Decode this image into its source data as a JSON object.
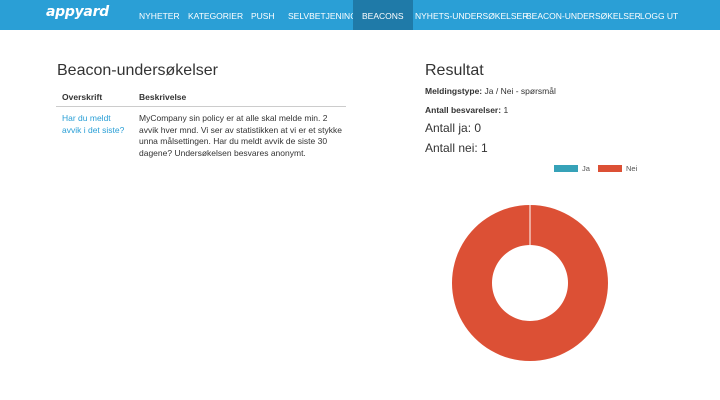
{
  "nav": {
    "logo": "appyard",
    "items": [
      "NYHETER",
      "KATEGORIER",
      "PUSH",
      "SELVBETJENING",
      "BEACONS",
      "NYHETS-UNDERSØKELSER",
      "BEACON-UNDERSØKELSER",
      "LOGG UT"
    ],
    "active": "BEACONS"
  },
  "left": {
    "title": "Beacon-undersøkelser",
    "columns": [
      "Overskrift",
      "Beskrivelse"
    ],
    "rows": [
      {
        "title": "Har du meldt avvik i det siste?",
        "description": "MyCompany sin policy er at alle skal melde min. 2 avvik hver mnd. Vi ser av statistikken at vi er et stykke unna målsettingen. Har du meldt avvik de siste 30 dagene? Undersøkelsen besvares anonymt."
      }
    ]
  },
  "right": {
    "title": "Resultat",
    "type_label": "Meldingstype:",
    "type_value": "Ja / Nei - spørsmål",
    "responses_label": "Antall besvarelser:",
    "responses_value": "1",
    "yes_text": "Antall ja: 0",
    "no_text": "Antall nei: 1"
  },
  "chart_data": {
    "type": "pie",
    "donut": true,
    "categories": [
      "Ja",
      "Nei"
    ],
    "values": [
      0,
      1
    ],
    "colors": [
      "#36a2b8",
      "#dc5035"
    ],
    "legend": "top-right"
  },
  "colors": {
    "navbar": "#2a9fd6",
    "nav_active": "#1f7aa8",
    "link": "#2a9fd6"
  }
}
